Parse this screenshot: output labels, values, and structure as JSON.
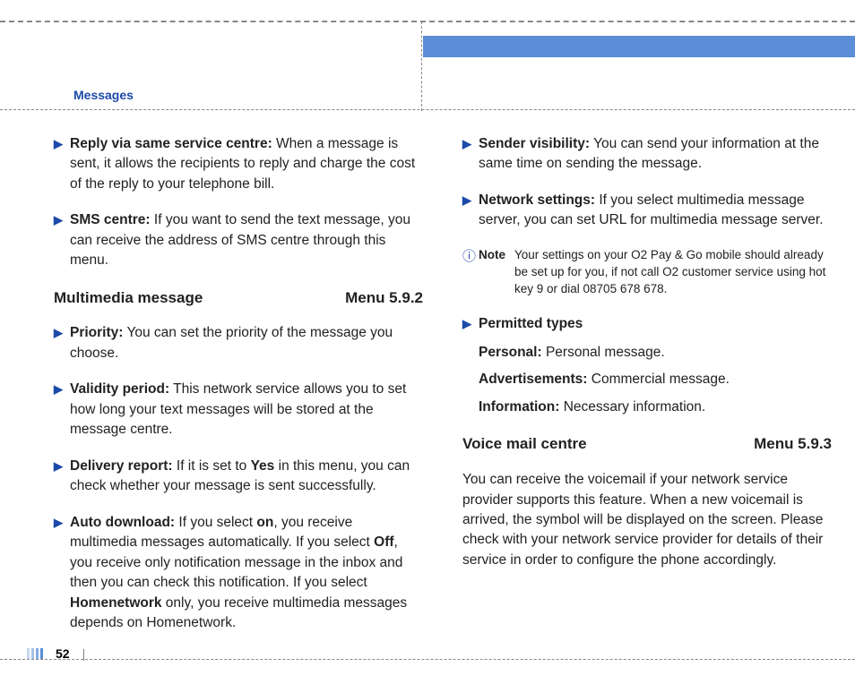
{
  "header": {
    "section": "Messages"
  },
  "page_number": "52",
  "col1": {
    "items_top": [
      {
        "label": "Reply via same service centre:",
        "text": " When a message is sent, it allows the recipients to reply and charge the cost of the reply to your telephone bill."
      },
      {
        "label": "SMS centre:",
        "text": " If you want to send the text message, you can receive the address of SMS centre through this menu."
      }
    ],
    "heading": {
      "title": "Multimedia message",
      "menu": "Menu 5.9.2"
    },
    "items": [
      {
        "label": "Priority:",
        "text": " You can set the priority of the message you choose."
      },
      {
        "label": "Validity period:",
        "text": " This network service allows you to set how long your text messages will be stored at the message centre."
      },
      {
        "label": "Delivery report:",
        "pre": " If it is set to ",
        "b1": "Yes",
        "post": " in this menu, you can check whether your message is sent successfully."
      },
      {
        "label": "Auto download:",
        "pre": " If you select ",
        "b1": "on",
        "mid1": ", you receive multimedia messages automatically. If you select ",
        "b2": "Off",
        "mid2": ", you receive only notification message in the inbox and then you can check this notification. If you select ",
        "b3": "Homenetwork",
        "post": " only, you receive multimedia messages depends on Homenetwork."
      }
    ]
  },
  "col2": {
    "items_top": [
      {
        "label": "Sender visibility:",
        "text": " You can send your information at the same time on sending the message."
      },
      {
        "label": "Network settings:",
        "text": " If you select multimedia message server, you can set URL for multimedia message server."
      }
    ],
    "note": {
      "label": "Note",
      "text": "Your settings on your O2 Pay & Go mobile should already be set up for you, if not call O2 customer service using hot key 9 or dial 08705 678 678."
    },
    "permitted": {
      "heading": "Permitted types",
      "rows": [
        {
          "label": "Personal:",
          "text": " Personal message."
        },
        {
          "label": "Advertisements:",
          "text": " Commercial message."
        },
        {
          "label": "Information:",
          "text": " Necessary information."
        }
      ]
    },
    "heading": {
      "title": "Voice mail centre",
      "menu": "Menu 5.9.3"
    },
    "paragraph": "You can receive the voicemail if your network service provider supports this feature. When a new voicemail is arrived, the symbol will be displayed on the screen. Please check with your network service provider for details of their service in order to configure the phone accordingly."
  }
}
